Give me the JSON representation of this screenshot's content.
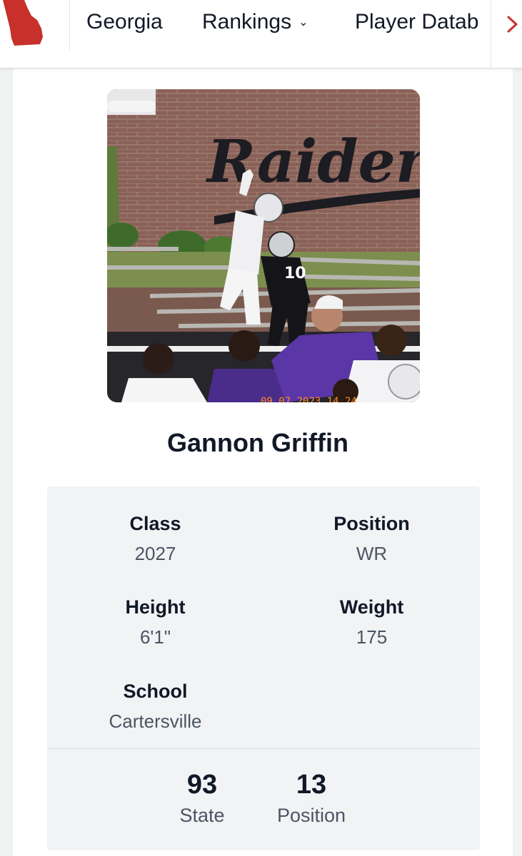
{
  "nav": {
    "items": [
      {
        "label": "Georgia"
      },
      {
        "label": "Rankings",
        "has_dropdown": true
      },
      {
        "label": "Player Datab"
      }
    ],
    "logo_icon": "georgia-state-icon",
    "more_icon": "chevron-right-icon",
    "accent_color": "#c8302b"
  },
  "player": {
    "name": "Gannon Griffin",
    "photo_icon": "player-photo",
    "photo_sign_text": "Raiders"
  },
  "info": {
    "class": {
      "label": "Class",
      "value": "2027"
    },
    "position": {
      "label": "Position",
      "value": "WR"
    },
    "height": {
      "label": "Height",
      "value": "6'1\""
    },
    "weight": {
      "label": "Weight",
      "value": "175"
    },
    "school": {
      "label": "School",
      "value": "Cartersville"
    }
  },
  "rankings": {
    "state": {
      "value": "93",
      "label": "State"
    },
    "position": {
      "value": "13",
      "label": "Position"
    }
  }
}
